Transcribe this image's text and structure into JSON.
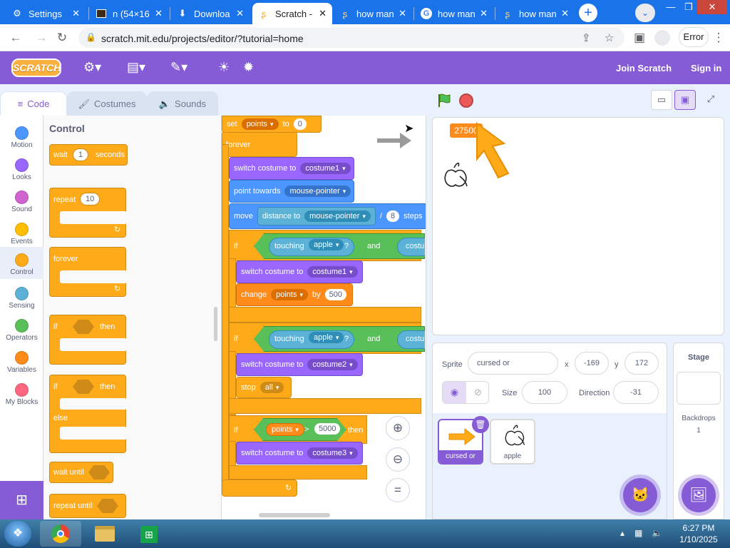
{
  "browser": {
    "tabs": [
      {
        "label": "Settings",
        "icon": "gear-icon",
        "active": false
      },
      {
        "label": "n (54×16",
        "icon": "image-icon",
        "active": false
      },
      {
        "label": "Downloa",
        "icon": "download-icon",
        "active": false
      },
      {
        "label": "Scratch -",
        "icon": "scratch-icon",
        "active": true
      },
      {
        "label": "how man",
        "icon": "scratch-icon",
        "active": false
      },
      {
        "label": "how man",
        "icon": "google-icon",
        "active": false
      },
      {
        "label": "how man",
        "icon": "scratch-icon",
        "active": false
      }
    ],
    "url": "scratch.mit.edu/projects/editor/?tutorial=home",
    "error_label": "Error"
  },
  "scratch_menu": {
    "logo": "SCRATCH",
    "join": "Join Scratch",
    "signin": "Sign in"
  },
  "editor_tabs": {
    "code": "Code",
    "costumes": "Costumes",
    "sounds": "Sounds"
  },
  "categories": [
    {
      "label": "Motion",
      "color": "#4c97ff"
    },
    {
      "label": "Looks",
      "color": "#9966ff"
    },
    {
      "label": "Sound",
      "color": "#cf63cf"
    },
    {
      "label": "Events",
      "color": "#ffbf00"
    },
    {
      "label": "Control",
      "color": "#ffab19"
    },
    {
      "label": "Sensing",
      "color": "#5cb1d6"
    },
    {
      "label": "Operators",
      "color": "#59c059"
    },
    {
      "label": "Variables",
      "color": "#ff8c1a"
    },
    {
      "label": "My Blocks",
      "color": "#ff6680"
    }
  ],
  "palette": {
    "heading": "Control",
    "wait": {
      "a": "wait",
      "val": "1",
      "b": "seconds"
    },
    "repeat": {
      "a": "repeat",
      "val": "10"
    },
    "forever": "forever",
    "if_then": {
      "a": "if",
      "b": "then"
    },
    "if_else": {
      "a": "if",
      "b": "then",
      "c": "else"
    },
    "wait_until": "wait until",
    "repeat_until": "repeat until"
  },
  "script": {
    "set": {
      "a": "set",
      "var": "points",
      "b": "to",
      "val": "0"
    },
    "forever": "forever",
    "switch1": {
      "a": "switch costume to",
      "val": "costume1"
    },
    "point": {
      "a": "point towards",
      "val": "mouse-pointer"
    },
    "move": {
      "a": "move",
      "b": "distance to",
      "val": "mouse-pointer",
      "c": "/",
      "n": "8",
      "d": "steps"
    },
    "if1": {
      "a": "if",
      "b": "touching",
      "obj": "apple",
      "q": "?",
      "and": "and",
      "c": "costu"
    },
    "switch2": {
      "a": "switch costume to",
      "val": "costume1"
    },
    "change": {
      "a": "change",
      "var": "points",
      "b": "by",
      "val": "500"
    },
    "if2": {
      "a": "if",
      "b": "touching",
      "obj": "apple",
      "q": "?",
      "and": "and",
      "c": "costu"
    },
    "switch3": {
      "a": "switch costume to",
      "val": "costume2"
    },
    "stop": {
      "a": "stop",
      "val": "all"
    },
    "if3": {
      "a": "if",
      "var": "points",
      "op": ">",
      "val": "5000",
      "b": "then"
    },
    "switch4": {
      "a": "switch costume to",
      "val": "costume3"
    }
  },
  "stage": {
    "monitor_value": "27500"
  },
  "sprite_info": {
    "sprite_label": "Sprite",
    "sprite_name": "cursed or",
    "x_label": "x",
    "x_value": "-169",
    "y_label": "y",
    "y_value": "172",
    "size_label": "Size",
    "size_value": "100",
    "direction_label": "Direction",
    "direction_value": "-31"
  },
  "sprites": [
    {
      "name": "cursed or",
      "selected": true
    },
    {
      "name": "apple",
      "selected": false
    }
  ],
  "stage_panel": {
    "title": "Stage",
    "backdrops_label": "Backdrops",
    "backdrops_count": "1"
  },
  "taskbar": {
    "time": "6:27 PM",
    "date": "1/10/2025"
  }
}
